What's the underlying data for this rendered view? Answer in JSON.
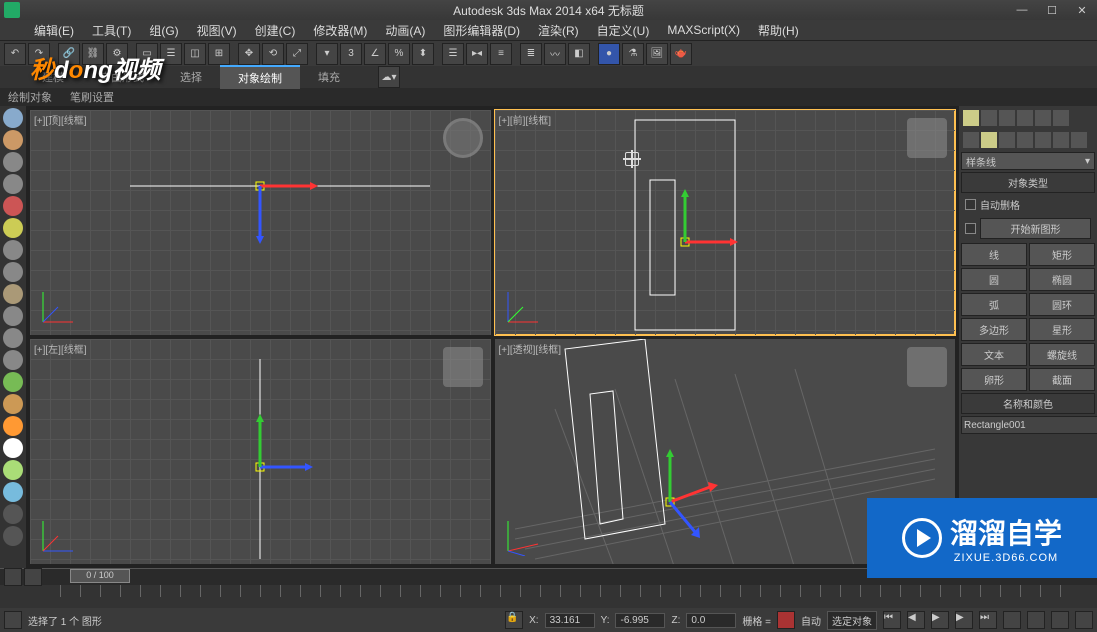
{
  "title": "Autodesk 3ds Max  2014 x64     无标题",
  "window_controls": {
    "min": "—",
    "max": "☐",
    "close": "✕"
  },
  "menu": [
    "编辑(E)",
    "工具(T)",
    "组(G)",
    "视图(V)",
    "创建(C)",
    "修改器(M)",
    "动画(A)",
    "图形编辑器(D)",
    "渲染(R)",
    "自定义(U)",
    "MAXScript(X)",
    "帮助(H)"
  ],
  "logo_overlay": "秒dong视频",
  "tabs": [
    "建模",
    "自由形式",
    "选择",
    "对象绘制",
    "填充"
  ],
  "active_tab_index": 3,
  "subtabs": [
    "绘制对象",
    "笔刷设置"
  ],
  "viewports": [
    {
      "label": "[+][顶][线框]",
      "kind": "ortho"
    },
    {
      "label": "[+][前][线框]",
      "kind": "ortho",
      "active": true,
      "cursor": true
    },
    {
      "label": "[+][左][线框]",
      "kind": "ortho"
    },
    {
      "label": "[+][透视][线框]",
      "kind": "persp"
    }
  ],
  "right_panel": {
    "dropdown": "样条线",
    "section1": "对象类型",
    "chk1": "自动删格",
    "btn_wide": "开始新图形",
    "buttons": [
      [
        "线",
        "矩形"
      ],
      [
        "圆",
        "椭圆"
      ],
      [
        "弧",
        "圆环"
      ],
      [
        "多边形",
        "星形"
      ],
      [
        "文本",
        "螺旋线"
      ],
      [
        "卵形",
        "截面"
      ]
    ],
    "section2": "名称和颜色",
    "obj_name": "Rectangle001"
  },
  "left_tools_colors": [
    "#8ac",
    "#c96",
    "#888",
    "#888",
    "#c55",
    "#cc5",
    "#888",
    "#888",
    "#888",
    "#888",
    "#888",
    "#888",
    "#7b5",
    "#c95",
    "#f93",
    "#fff",
    "#ad7",
    "#7bd",
    "#555",
    "#555"
  ],
  "timeline": {
    "slider": "0 / 100"
  },
  "status": {
    "selection": "选择了 1 个 图形",
    "x_label": "X:",
    "x_val": "33.161",
    "y_label": "Y:",
    "y_val": "-6.995",
    "z_label": "Z:",
    "z_val": "0.0",
    "grid": "栅格 =",
    "auto": "自动",
    "sel_mode": "选定对象"
  },
  "corner_logo": {
    "title": "溜溜自学",
    "sub": "ZIXUE.3D66.COM"
  }
}
